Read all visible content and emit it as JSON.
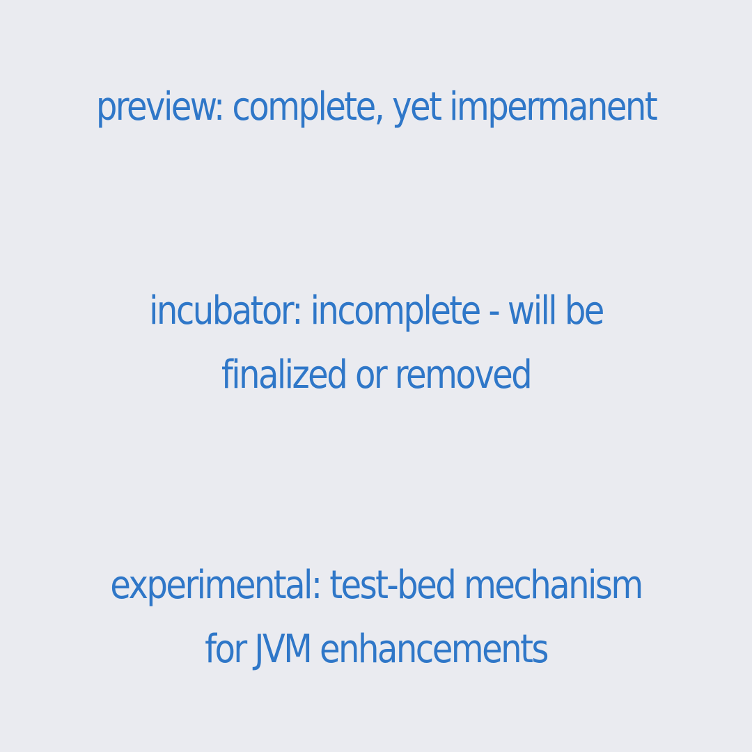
{
  "colors": {
    "background": "#eaebf0",
    "text": "#2f77c8"
  },
  "statements": [
    {
      "lines": [
        "preview: complete, yet impermanent"
      ]
    },
    {
      "lines": [
        "incubator: incomplete - will be",
        "finalized or removed"
      ]
    },
    {
      "lines": [
        "experimental: test-bed mechanism",
        "for JVM enhancements"
      ]
    }
  ]
}
